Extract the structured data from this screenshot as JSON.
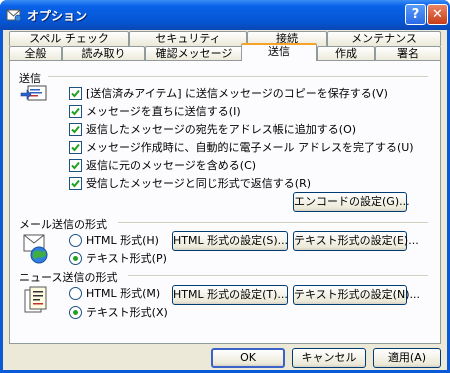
{
  "window": {
    "title": "オプション",
    "help_label": "?",
    "close_label": "✕"
  },
  "tabs_back": [
    {
      "label": "スペル チェック"
    },
    {
      "label": "セキュリティ"
    },
    {
      "label": "接続"
    },
    {
      "label": "メンテナンス"
    }
  ],
  "tabs_front": [
    {
      "label": "全般"
    },
    {
      "label": "読み取り"
    },
    {
      "label": "確認メッセージ"
    },
    {
      "label": "送信",
      "active": true
    },
    {
      "label": "作成"
    },
    {
      "label": "署名"
    }
  ],
  "send_group": {
    "label": "送信",
    "icon": "outbox-icon",
    "options": [
      {
        "label": "[送信済みアイテム] に送信メッセージのコピーを保存する(V)",
        "checked": true
      },
      {
        "label": "メッセージを直ちに送信する(I)",
        "checked": true
      },
      {
        "label": "返信したメッセージの宛先をアドレス帳に追加する(O)",
        "checked": true
      },
      {
        "label": "メッセージ作成時に、自動的に電子メール アドレスを完了する(U)",
        "checked": true
      },
      {
        "label": "返信に元のメッセージを含める(C)",
        "checked": true
      },
      {
        "label": "受信したメッセージと同じ形式で返信する(R)",
        "checked": true
      }
    ],
    "encode_button": "エンコードの設定(G)..."
  },
  "mail_format": {
    "label": "メール送信の形式",
    "icon": "mail-globe-icon",
    "html_option": "HTML 形式(H)",
    "text_option": "テキスト形式(P)",
    "selected": "text",
    "html_settings_button": "HTML 形式の設定(S)...",
    "text_settings_button": "テキスト形式の設定(E)..."
  },
  "news_format": {
    "label": "ニュース送信の形式",
    "icon": "news-document-icon",
    "html_option": "HTML 形式(M)",
    "text_option": "テキスト形式(X)",
    "selected": "text",
    "html_settings_button": "HTML 形式の設定(T)...",
    "text_settings_button": "テキスト形式の設定(N)..."
  },
  "footer": {
    "ok": "OK",
    "cancel": "キャンセル",
    "apply": "適用(A)"
  },
  "colors": {
    "titlebar": "#0556d5",
    "dialog_bg": "#ece9d8",
    "active_tab_accent": "#f7a32a",
    "check_mark": "#21a121"
  }
}
